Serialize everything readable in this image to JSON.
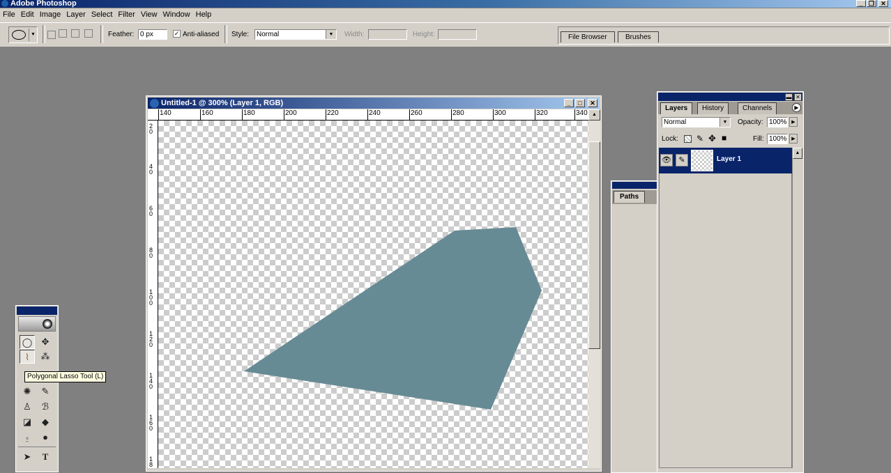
{
  "app": {
    "title": "Adobe Photoshop"
  },
  "window_buttons": {
    "minimize": "_",
    "restore": "❐",
    "close": "✕"
  },
  "menu": [
    "File",
    "Edit",
    "Image",
    "Layer",
    "Select",
    "Filter",
    "View",
    "Window",
    "Help"
  ],
  "options": {
    "tool_preset_icon": "ellipse-marquee-icon",
    "feather_label": "Feather:",
    "feather_value": "0 px",
    "antialiased_label": "Anti-aliased",
    "antialiased_checked": true,
    "style_label": "Style:",
    "style_value": "Normal",
    "width_label": "Width:",
    "width_value": "",
    "height_label": "Height:",
    "height_value": ""
  },
  "palette_well": {
    "tabs": [
      "File Browser",
      "Brushes"
    ]
  },
  "document": {
    "title": "Untitled-1 @ 300% (Layer 1, RGB)",
    "ruler_h_labels": [
      "140",
      "160",
      "180",
      "200",
      "220",
      "240",
      "260",
      "280",
      "300",
      "320",
      "340"
    ],
    "ruler_v_labels": [
      "2\n0",
      "4\n0",
      "6\n0",
      "8\n0",
      "1\n0\n0",
      "1\n2\n0",
      "1\n4\n0",
      "1\n6\n0",
      "1\n8"
    ],
    "shape_color": "#678b94"
  },
  "toolbox": {
    "tooltip": "Polygonal Lasso Tool (L)",
    "tools": [
      {
        "name": "ellipse-marquee-tool-icon",
        "glyph": "◯"
      },
      {
        "name": "move-tool-icon",
        "glyph": "✥"
      },
      {
        "name": "polygonal-lasso-tool-icon",
        "glyph": "⌇"
      },
      {
        "name": "magic-wand-tool-icon",
        "glyph": "⁂"
      },
      {
        "name": "healing-brush-tool-icon",
        "glyph": "✺"
      },
      {
        "name": "brush-tool-icon",
        "glyph": "✎"
      },
      {
        "name": "clone-stamp-tool-icon",
        "glyph": "♙"
      },
      {
        "name": "history-brush-tool-icon",
        "glyph": "ℬ"
      },
      {
        "name": "eraser-tool-icon",
        "glyph": "◪"
      },
      {
        "name": "paint-bucket-tool-icon",
        "glyph": "◆"
      },
      {
        "name": "blur-tool-icon",
        "glyph": "⍛"
      },
      {
        "name": "dodge-tool-icon",
        "glyph": "●"
      },
      {
        "name": "path-selection-tool-icon",
        "glyph": "➤"
      },
      {
        "name": "type-tool-icon",
        "glyph": "T"
      }
    ]
  },
  "paths_panel": {
    "tab": "Paths"
  },
  "layers_panel": {
    "tabs": [
      "Layers",
      "History",
      "Channels"
    ],
    "blend_mode": "Normal",
    "opacity_label": "Opacity:",
    "opacity_value": "100%",
    "lock_label": "Lock:",
    "fill_label": "Fill:",
    "fill_value": "100%",
    "layers": [
      {
        "name": "Layer 1",
        "visible": true,
        "selected": true
      }
    ]
  }
}
